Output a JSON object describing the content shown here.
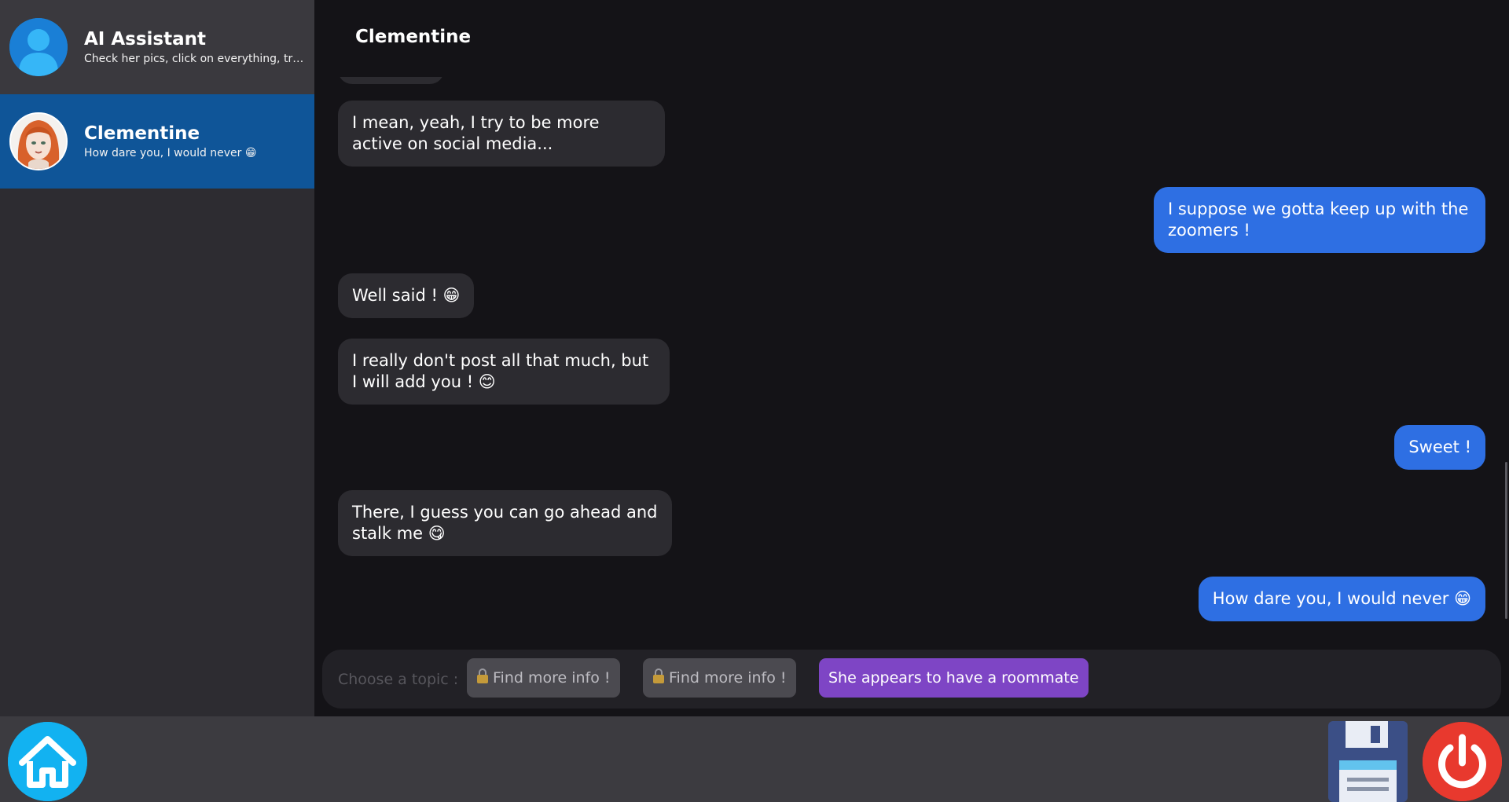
{
  "sidebar": {
    "contacts": [
      {
        "name": "AI Assistant",
        "preview": "Check her pics, click on everything, try to get the most out of this conversation !"
      },
      {
        "name": "Clementine",
        "preview": "How dare you, I would never 😁"
      }
    ]
  },
  "chat": {
    "title": "Clementine",
    "messages": [
      {
        "from": "her",
        "text": "I mean, yeah, I try to be more active on social media..."
      },
      {
        "from": "me",
        "text": "I suppose we gotta keep up with the zoomers !"
      },
      {
        "from": "her",
        "text": "Well said ! 😁"
      },
      {
        "from": "her",
        "text": "I really don't post all that much, but I will add you ! 😊"
      },
      {
        "from": "me",
        "text": "Sweet !"
      },
      {
        "from": "her",
        "text": "There, I guess you can go ahead and stalk me 😋"
      },
      {
        "from": "me",
        "text": "How dare you, I would never 😁"
      }
    ]
  },
  "topics": {
    "label": "Choose a topic :",
    "buttons": [
      {
        "label": "Find more info !",
        "locked": true
      },
      {
        "label": "Find more info !",
        "locked": true
      },
      {
        "label": "She appears to have a roommate",
        "locked": false
      }
    ]
  },
  "colors": {
    "sent_bubble": "#2e6fe3",
    "received_bubble": "#2c2b30",
    "active_contact": "#0f5598",
    "topic_active": "#7e45c5",
    "home": "#13b1f0",
    "power": "#e8392e"
  },
  "icons": [
    "user-icon",
    "lock-icon",
    "home-icon",
    "save-icon",
    "power-icon"
  ]
}
